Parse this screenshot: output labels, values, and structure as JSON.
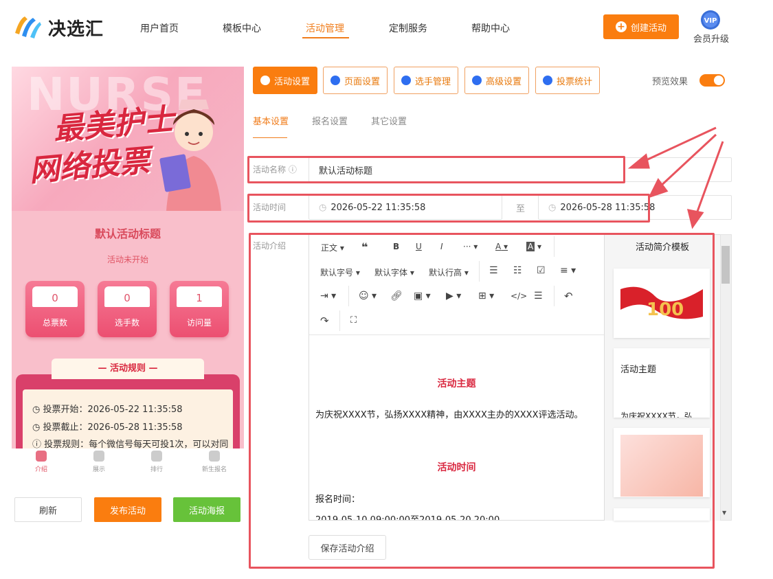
{
  "header": {
    "logo_text": "决选汇",
    "nav": [
      "用户首页",
      "模板中心",
      "活动管理",
      "定制服务",
      "帮助中心"
    ],
    "create_button": "创建活动",
    "vip_badge": "VIP",
    "vip_label": "会员升级"
  },
  "preview": {
    "banner_bg_word": "NURSE",
    "banner_line1": "最美护士",
    "banner_line2": "网络投票",
    "title": "默认活动标题",
    "status": "活动未开始",
    "stats": [
      {
        "value": "0",
        "label": "总票数"
      },
      {
        "value": "0",
        "label": "选手数"
      },
      {
        "value": "1",
        "label": "访问量"
      }
    ],
    "rules_title": "— 活动规则 —",
    "rules": [
      "投票开始：2026-05-22 11:35:58",
      "投票截止：2026-05-28 11:35:58",
      "投票规则：每个微信号每天可投1次，可以对同"
    ],
    "tabbar": [
      "介绍",
      "展示",
      "排行",
      "新生报名"
    ]
  },
  "left_buttons": {
    "refresh": "刷新",
    "publish": "发布活动",
    "poster": "活动海报"
  },
  "tabs": [
    "活动设置",
    "页面设置",
    "选手管理",
    "高级设置",
    "投票统计"
  ],
  "preview_label": "预览效果",
  "subtabs": [
    "基本设置",
    "报名设置",
    "其它设置"
  ],
  "form": {
    "name_label": "活动名称",
    "name_value": "默认活动标题",
    "time_label": "活动时间",
    "time_start": "2026-05-22 11:35:58",
    "time_sep": "至",
    "time_end": "2026-05-28 11:35:58",
    "intro_label": "活动介绍"
  },
  "toolbar": {
    "row1": [
      "正文",
      "❝",
      "B",
      "U",
      "I",
      "···",
      "A",
      "A"
    ],
    "row2": [
      "默认字号",
      "默认字体",
      "默认行高"
    ]
  },
  "editor": {
    "h1": "活动主题",
    "p1": "为庆祝XXXX节，弘扬XXXX精神，由XXXX主办的XXXX评选活动。",
    "h2": "活动时间",
    "p2": "报名时间：",
    "p3": "2019-05-10 09:00:00至2019-05-20 20:00"
  },
  "templates": {
    "title": "活动简介模板",
    "card2_title": "活动主题",
    "card2_text": "为庆祝XXXX节，弘"
  },
  "save_intro": "保存活动介绍",
  "colors": {
    "accent": "#fa7d0f",
    "highlight": "#e8545e",
    "green": "#67c23a"
  }
}
